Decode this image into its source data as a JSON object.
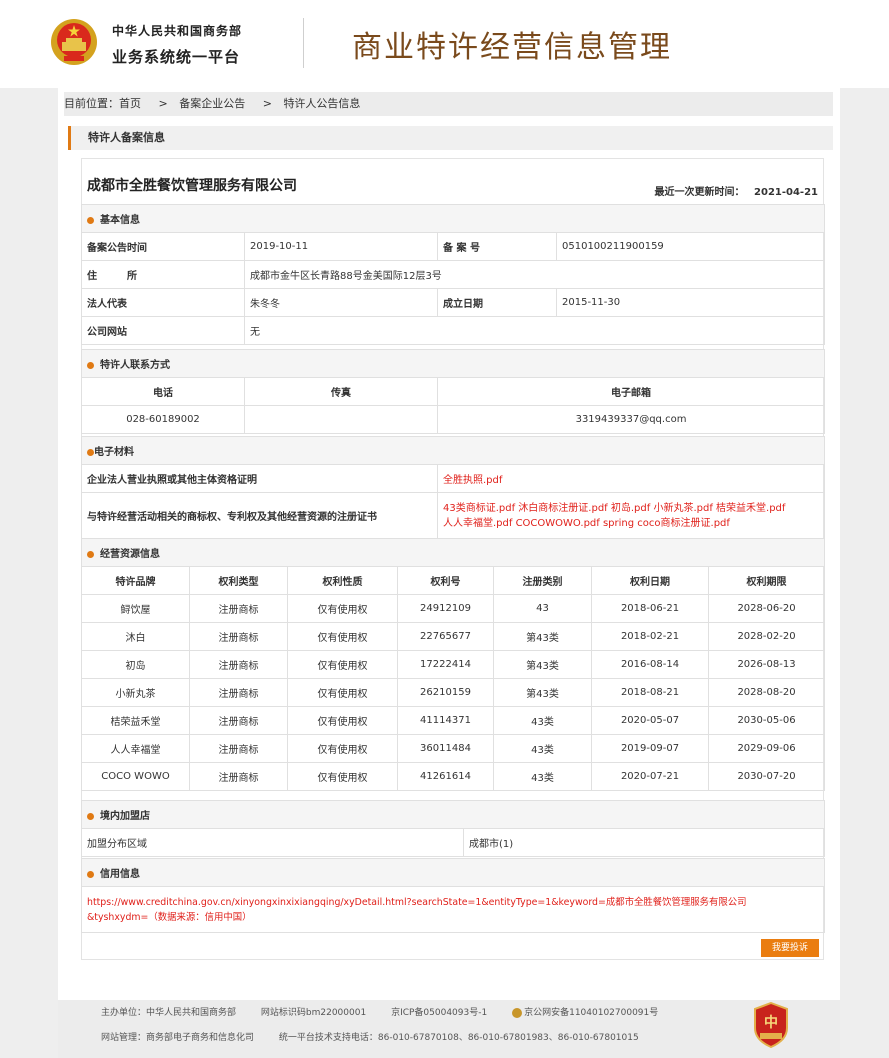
{
  "header": {
    "org_name": "中华人民共和国商务部",
    "system_name": "业务系统统一平台",
    "page_title": "商业特许经营信息管理"
  },
  "breadcrumb": {
    "prefix": "目前位置：",
    "home": "首页",
    "sep": ">",
    "item1": "备案企业公告",
    "item2": "特许人公告信息"
  },
  "section_title": "特许人备案信息",
  "company": {
    "name": "成都市全胜餐饮管理服务有限公司",
    "updated_label": "最近一次更新时间：",
    "updated_date": "2021-04-21"
  },
  "basic": {
    "title": "基本信息",
    "announce_time_label": "备案公告时间",
    "announce_time": "2019-10-11",
    "record_no_label": "备 案 号",
    "record_no": "0510100211900159",
    "address_label": "住　　　所",
    "address": "成都市金牛区长青路88号金美国际12层3号",
    "legal_rep_label": "法人代表",
    "legal_rep": "朱冬冬",
    "established_label": "成立日期",
    "established": "2015-11-30",
    "website_label": "公司网站",
    "website": "无"
  },
  "contact": {
    "title": "特许人联系方式",
    "phone_label": "电话",
    "fax_label": "传真",
    "email_label": "电子邮箱",
    "phone": "028-60189002",
    "fax": "",
    "email": "3319439337@qq.com"
  },
  "materials": {
    "title": "电子材料",
    "license_label": "企业法人营业执照或其他主体资格证明",
    "license_file": "全胜执照.pdf",
    "trademark_label": "与特许经营活动相关的商标权、专利权及其他经营资源的注册证书",
    "trademark_files_line1": "43类商标证.pdf 沐白商标注册证.pdf 初岛.pdf 小新丸茶.pdf 桔荣益禾堂.pdf",
    "trademark_files_line2": "人人幸福堂.pdf COCOWOWO.pdf spring coco商标注册证.pdf"
  },
  "resources": {
    "title": "经营资源信息",
    "headers": [
      "特许品牌",
      "权利类型",
      "权利性质",
      "权利号",
      "注册类别",
      "权利日期",
      "权利期限"
    ],
    "rows": [
      [
        "鲟饮屋",
        "注册商标",
        "仅有使用权",
        "24912109",
        "43",
        "2018-06-21",
        "2028-06-20"
      ],
      [
        "沐白",
        "注册商标",
        "仅有使用权",
        "22765677",
        "第43类",
        "2018-02-21",
        "2028-02-20"
      ],
      [
        "初岛",
        "注册商标",
        "仅有使用权",
        "17222414",
        "第43类",
        "2016-08-14",
        "2026-08-13"
      ],
      [
        "小新丸茶",
        "注册商标",
        "仅有使用权",
        "26210159",
        "第43类",
        "2018-08-21",
        "2028-08-20"
      ],
      [
        "桔荣益禾堂",
        "注册商标",
        "仅有使用权",
        "41114371",
        "43类",
        "2020-05-07",
        "2030-05-06"
      ],
      [
        "人人幸福堂",
        "注册商标",
        "仅有使用权",
        "36011484",
        "43类",
        "2019-09-07",
        "2029-09-06"
      ],
      [
        "COCO WOWO",
        "注册商标",
        "仅有使用权",
        "41261614",
        "43类",
        "2020-07-21",
        "2030-07-20"
      ]
    ]
  },
  "franchise": {
    "title": "境内加盟店",
    "area_label": "加盟分布区域",
    "area_value": "成都市(1)"
  },
  "credit": {
    "title": "信用信息",
    "line1": "https://www.creditchina.gov.cn/xinyongxinxixiangqing/xyDetail.html?searchState=1&entityType=1&keyword=成都市全胜餐饮管理服务有限公司",
    "line2": "&tyshxydm=（数据来源：信用中国）"
  },
  "complaint_button": "我要投诉",
  "footer": {
    "sponsor": "主办单位：中华人民共和国商务部",
    "site_id": "网站标识码bm22000001",
    "icp": "京ICP备05004093号-1",
    "police": "京公网安备11040102700091号",
    "manager": "网站管理：商务部电子商务和信息化司",
    "support": "统一平台技术支持电话：86-010-67870108、86-010-67801983、86-010-67801015"
  },
  "colors": {
    "accent": "#e07a14",
    "title_brown": "#7a4a1c",
    "link_red": "#e0211b",
    "button": "#ea7d10"
  }
}
